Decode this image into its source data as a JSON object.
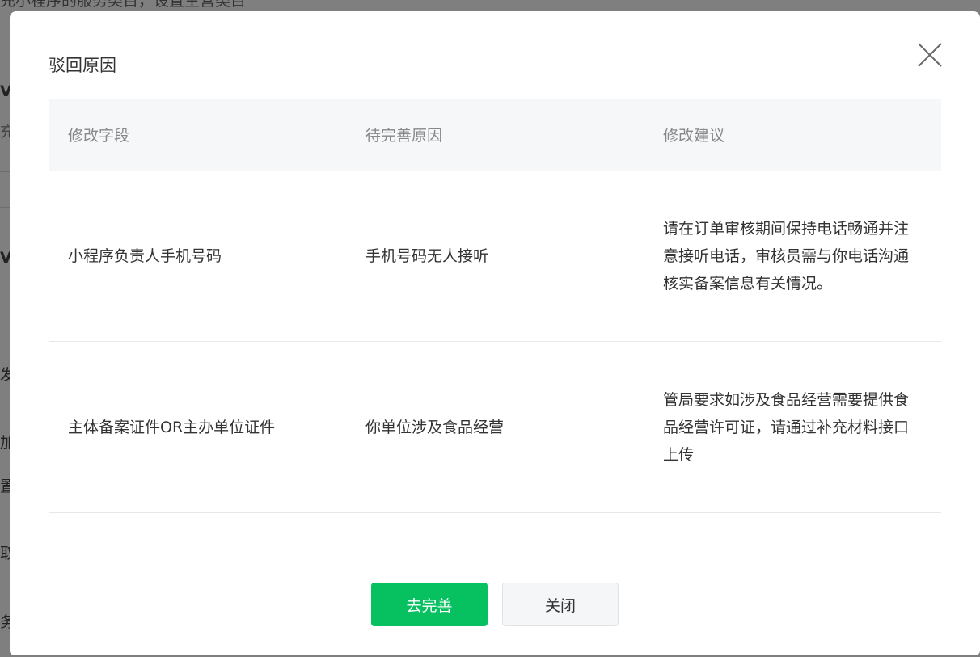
{
  "background": {
    "top_text": "充小程序的服务类目，设置主营类目",
    "side_fragments": [
      "V",
      "充",
      "V",
      "发",
      "加",
      "置",
      "取",
      "务"
    ]
  },
  "dialog": {
    "title": "驳回原因",
    "table": {
      "headers": [
        "修改字段",
        "待完善原因",
        "修改建议"
      ],
      "rows": [
        {
          "field": "小程序负责人手机号码",
          "reason": "手机号码无人接听",
          "suggestion": "请在订单审核期间保持电话畅通并注意接听电话，审核员需与你电话沟通核实备案信息有关情况。"
        },
        {
          "field": "主体备案证件OR主办单位证件",
          "reason": "你单位涉及食品经营",
          "suggestion": "管局要求如涉及食品经营需要提供食品经营许可证，请通过补充材料接口上传"
        }
      ]
    },
    "buttons": {
      "primary_label": "去完善",
      "secondary_label": "关闭"
    }
  },
  "colors": {
    "primary": "#07c160",
    "header_bg": "#f6f7f9",
    "overlay": "rgba(0,0,0,0.5)"
  }
}
